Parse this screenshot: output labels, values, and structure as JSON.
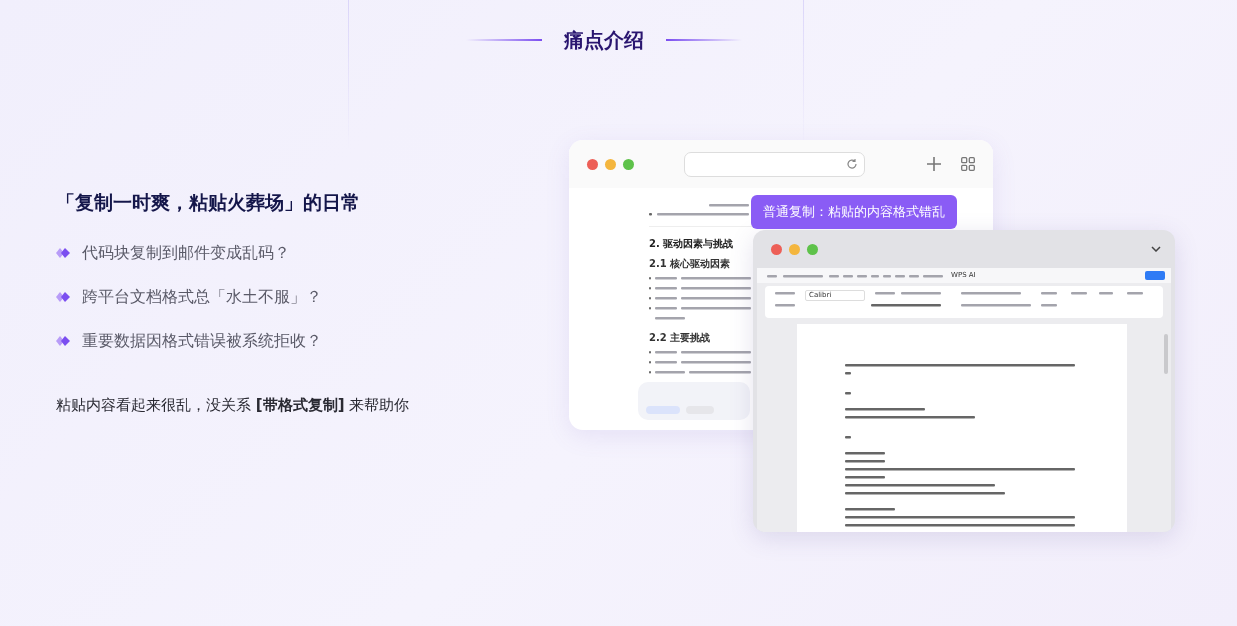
{
  "section_title": "痛点介绍",
  "heading": "「复制一时爽，粘贴火葬场」的日常",
  "pain_points": [
    "代码块复制到邮件变成乱码？",
    "跨平台文档格式总「水土不服」？",
    "重要数据因格式错误被系统拒收？"
  ],
  "conclusion": "粘贴内容看起来很乱，没关系 **[带格式复制]** 来帮助你",
  "browser_window": {
    "section_heading": "2. 驱动因素与挑战",
    "subsections": [
      "2.1 核心驱动因素",
      "2.2 主要挑战"
    ]
  },
  "tooltip": "普通复制：粘贴的内容格式错乱",
  "editor_window": {
    "ai_button": "WPS AI",
    "font": "Calibri"
  }
}
